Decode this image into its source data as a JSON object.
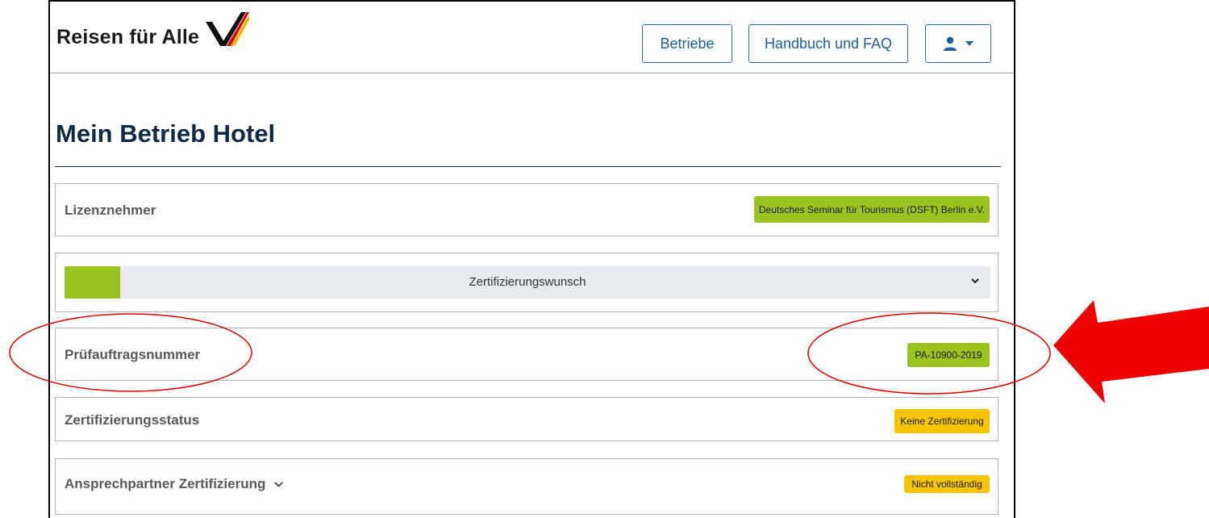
{
  "header": {
    "logo_text": "Reisen für Alle",
    "nav": {
      "betriebe_label": "Betriebe",
      "faq_label": "Handbuch und FAQ"
    }
  },
  "main": {
    "title": "Mein Betrieb Hotel",
    "rows": {
      "lizenznehmer": {
        "label": "Lizenznehmer",
        "badge": "Deutsches Seminar für Tourismus (DSFT) Berlin e.V."
      },
      "zertifizierungswunsch": {
        "label": "Zertifizierungswunsch",
        "progress_fraction": 0.06
      },
      "pruefauftragsnummer": {
        "label": "Prüfauftragsnummer",
        "badge": "PA-10900-2019"
      },
      "zertifizierungsstatus": {
        "label": "Zertifizierungsstatus",
        "badge": "Keine Zertifizierung"
      },
      "ansprechpartner": {
        "label": "Ansprechpartner Zertifizierung",
        "badge": "Nicht vollständig"
      }
    }
  },
  "colors": {
    "accent_green": "#9bc31f",
    "status_yellow": "#f7c600",
    "nav_blue": "#1f5f9a",
    "annotation_red": "#e00000"
  },
  "icons": {
    "user": "user-icon",
    "caret": "caret-down-icon",
    "chevron": "chevron-down-icon"
  }
}
